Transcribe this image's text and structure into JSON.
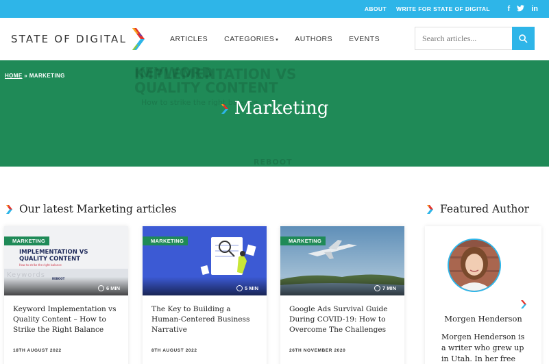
{
  "topbar": {
    "links": [
      "ABOUT",
      "WRITE FOR STATE OF DIGITAL"
    ],
    "social": [
      "f",
      "t",
      "in"
    ],
    "color": "#2eb5e8"
  },
  "header": {
    "logo_text": "STATE OF DIGITAL",
    "nav": [
      "ARTICLES",
      "CATEGORIES",
      "AUTHORS",
      "EVENTS"
    ],
    "search_placeholder": "Search articles..."
  },
  "hero": {
    "breadcrumb_home": "HOME",
    "breadcrumb_sep": "»",
    "breadcrumb_current": "MARKETING",
    "title": "Marketing",
    "bg_text": {
      "line1": "KEYWORD",
      "line2": "IMPLEMENTATION VS",
      "line3": "QUALITY CONTENT",
      "line4": "How to strike the right balance",
      "line5": "REBOOT"
    },
    "color": "#1f8a57"
  },
  "sections": {
    "latest": "Our latest Marketing articles",
    "featured": "Featured Author"
  },
  "articles": [
    {
      "tag": "MARKETING",
      "read_time": "6 MIN",
      "title": "Keyword Implementation vs Quality Content – How to Strike the Right Balance",
      "date": "18TH AUGUST 2022",
      "thumb_text": [
        "IMPLEMENTATION VS",
        "QUALITY CONTENT",
        "How to strike the right balance",
        "REBOOT"
      ]
    },
    {
      "tag": "MARKETING",
      "read_time": "5 MIN",
      "title": "The Key to Building a Human-Centered Business Narrative",
      "date": "8TH AUGUST 2022"
    },
    {
      "tag": "MARKETING",
      "read_time": "7 MIN",
      "title": "Google Ads Survival Guide During COVID-19: How to Overcome The Challenges",
      "date": "26TH NOVEMBER 2020"
    }
  ],
  "featured_author": {
    "name": "Morgen Henderson",
    "bio": "Morgen Henderson is a writer who grew up in Utah. In her free time,"
  }
}
